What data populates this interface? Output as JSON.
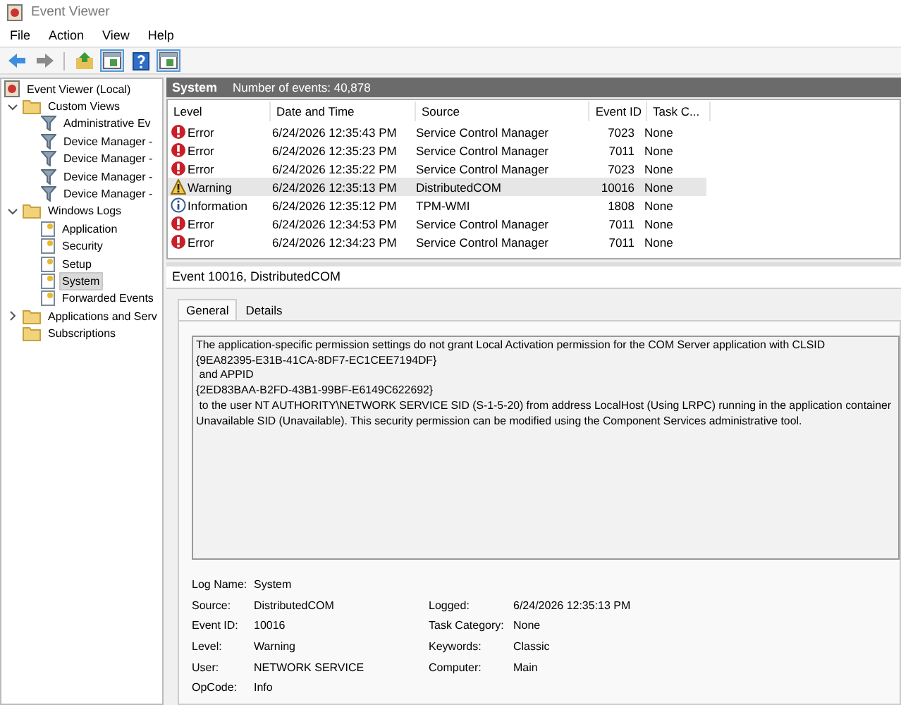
{
  "window": {
    "title": "Event Viewer"
  },
  "menu": [
    "File",
    "Action",
    "View",
    "Help"
  ],
  "toolbar": [
    {
      "kind": "back",
      "pressed": false
    },
    {
      "kind": "forward",
      "pressed": false
    },
    {
      "kind": "up",
      "pressed": false
    },
    {
      "kind": "pane",
      "pressed": true
    },
    {
      "kind": "help",
      "pressed": false
    },
    {
      "kind": "pane",
      "pressed": true
    }
  ],
  "tree": [
    {
      "label": "Event Viewer (Local)",
      "kind": "computer",
      "selected": false,
      "children": [
        {
          "label": "Custom Views",
          "kind": "folder",
          "selected": false,
          "expanded": true,
          "children": [
            {
              "label": "Administrative Ev",
              "kind": "filter",
              "selected": false
            },
            {
              "label": "Device Manager -",
              "kind": "filter",
              "selected": false
            },
            {
              "label": "Device Manager -",
              "kind": "filter",
              "selected": false
            },
            {
              "label": "Device Manager -",
              "kind": "filter",
              "selected": false
            },
            {
              "label": "Device Manager -",
              "kind": "filter",
              "selected": false
            }
          ]
        },
        {
          "label": "Windows Logs",
          "kind": "folder",
          "selected": false,
          "expanded": true,
          "children": [
            {
              "label": "Application",
              "kind": "log",
              "selected": false
            },
            {
              "label": "Security",
              "kind": "log",
              "selected": false
            },
            {
              "label": "Setup",
              "kind": "log",
              "selected": false
            },
            {
              "label": "System",
              "kind": "log",
              "selected": true
            },
            {
              "label": "Forwarded Events",
              "kind": "log",
              "selected": false
            }
          ]
        },
        {
          "label": "Applications and Serv",
          "kind": "folder",
          "selected": false,
          "expanded": false
        },
        {
          "label": "Subscriptions",
          "kind": "folder",
          "selected": false
        }
      ]
    }
  ],
  "log_header": {
    "title": "System",
    "count": "Number of events: 40,878"
  },
  "table": {
    "columns": [
      "Level",
      "Date and Time",
      "Source",
      "Event ID",
      "Task C..."
    ],
    "rows": [
      {
        "kind": "error",
        "level": "Error",
        "date": "6/24/2026 12:35:43 PM",
        "source": "Service Control Manager",
        "event_id": "7023",
        "task": "None",
        "selected": false
      },
      {
        "kind": "error",
        "level": "Error",
        "date": "6/24/2026 12:35:23 PM",
        "source": "Service Control Manager",
        "event_id": "7011",
        "task": "None",
        "selected": false
      },
      {
        "kind": "error",
        "level": "Error",
        "date": "6/24/2026 12:35:22 PM",
        "source": "Service Control Manager",
        "event_id": "7023",
        "task": "None",
        "selected": false
      },
      {
        "kind": "warning",
        "level": "Warning",
        "date": "6/24/2026 12:35:13 PM",
        "source": "DistributedCOM",
        "event_id": "10016",
        "task": "None",
        "selected": true
      },
      {
        "kind": "information",
        "level": "Information",
        "date": "6/24/2026 12:35:12 PM",
        "source": "TPM-WMI",
        "event_id": "1808",
        "task": "None",
        "selected": false
      },
      {
        "kind": "error",
        "level": "Error",
        "date": "6/24/2026 12:34:53 PM",
        "source": "Service Control Manager",
        "event_id": "7011",
        "task": "None",
        "selected": false
      },
      {
        "kind": "error",
        "level": "Error",
        "date": "6/24/2026 12:34:23 PM",
        "source": "Service Control Manager",
        "event_id": "7011",
        "task": "None",
        "selected": false
      }
    ]
  },
  "detail": {
    "title": "Event 10016, DistributedCOM",
    "tabs": [
      {
        "label": "General",
        "selected": true
      },
      {
        "label": "Details",
        "selected": false
      }
    ],
    "message": "The application-specific permission settings do not grant Local Activation permission for the COM Server application with CLSID\n{9EA82395-E31B-41CA-8DF7-EC1CEE7194DF}\n and APPID\n{2ED83BAA-B2FD-43B1-99BF-E6149C622692}\n to the user NT AUTHORITY\\NETWORK SERVICE SID (S-1-5-20) from address LocalHost (Using LRPC) running in the application container\nUnavailable SID (Unavailable). This security permission can be modified using the Component Services administrative tool.",
    "property_rows": [
      {
        "left": {
          "label": "Log Name:",
          "value": "System"
        }
      },
      {
        "left": {
          "label": "Source:",
          "value": "DistributedCOM"
        },
        "right": {
          "label": "Logged:",
          "value": "6/24/2026 12:35:13 PM"
        }
      },
      {
        "left": {
          "label": "Event ID:",
          "value": "10016"
        },
        "right": {
          "label": "Task Category:",
          "value": "None"
        }
      },
      {
        "left": {
          "label": "Level:",
          "value": "Warning"
        },
        "right": {
          "label": "Keywords:",
          "value": "Classic"
        }
      },
      {
        "left": {
          "label": "User:",
          "value": "NETWORK SERVICE"
        },
        "right": {
          "label": "Computer:",
          "value": "Main"
        }
      },
      {
        "left": {
          "label": "OpCode:",
          "value": "Info"
        }
      }
    ]
  }
}
